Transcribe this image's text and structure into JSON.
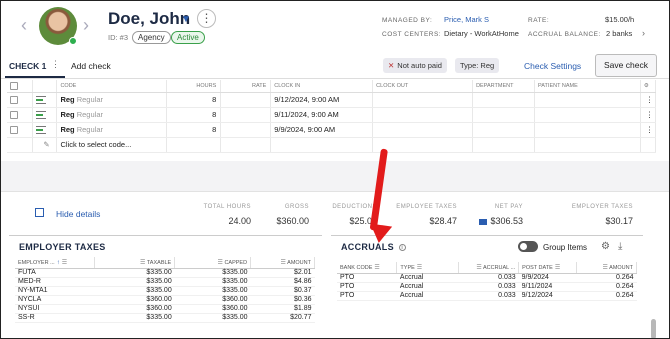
{
  "employee": {
    "name": "Doe, John",
    "id_label": "ID: #3",
    "badges": [
      "Agency",
      "Active"
    ]
  },
  "meta": {
    "managed_by_label": "MANAGED BY:",
    "managed_by_value": "Price, Mark S",
    "cost_centers_label": "COST CENTERS:",
    "cost_centers_value": "Dietary - WorkAtHome",
    "rate_label": "RATE:",
    "rate_value": "$15.00/h",
    "accrual_label": "ACCRUAL BALANCE:",
    "accrual_value": "2 banks"
  },
  "tabs": {
    "check1": "CHECK 1",
    "add_check": "Add check",
    "chip_not_auto_paid": "Not auto paid",
    "chip_type": "Type: Reg",
    "check_settings": "Check Settings",
    "save_check": "Save check"
  },
  "pay_table": {
    "columns": [
      "CODE",
      "HOURS",
      "RATE",
      "CLOCK IN",
      "CLOCK OUT",
      "DEPARTMENT",
      "PATIENT NAME"
    ],
    "rows": [
      {
        "code": "Reg",
        "type": "Regular",
        "hours": "8",
        "clock_in": "9/12/2024, 9:00 AM"
      },
      {
        "code": "Reg",
        "type": "Regular",
        "hours": "8",
        "clock_in": "9/11/2024, 9:00 AM"
      },
      {
        "code": "Reg",
        "type": "Regular",
        "hours": "8",
        "clock_in": "9/9/2024, 9:00 AM"
      }
    ],
    "new_row_placeholder": "Click to select code..."
  },
  "summary": {
    "hide_details": "Hide details",
    "items": [
      {
        "label": "TOTAL HOURS",
        "value": "24.00"
      },
      {
        "label": "GROSS",
        "value": "$360.00"
      },
      {
        "label": "DEDUCTIONS",
        "value": "$25.00"
      },
      {
        "label": "EMPLOYEE TAXES",
        "value": "$28.47"
      },
      {
        "label": "NET PAY",
        "value": "$306.53"
      },
      {
        "label": "EMPLOYER TAXES",
        "value": "$30.17"
      }
    ]
  },
  "employer_taxes": {
    "title": "EMPLOYER TAXES",
    "columns": [
      "EMPLOYER ...",
      "TAXABLE",
      "CAPPED",
      "AMOUNT"
    ],
    "rows": [
      {
        "name": "FUTA",
        "taxable": "$335.00",
        "capped": "$335.00",
        "amount": "$2.01"
      },
      {
        "name": "MED-R",
        "taxable": "$335.00",
        "capped": "$335.00",
        "amount": "$4.86"
      },
      {
        "name": "NY-MTA1",
        "taxable": "$335.00",
        "capped": "$335.00",
        "amount": "$0.37"
      },
      {
        "name": "NYCLA",
        "taxable": "$360.00",
        "capped": "$360.00",
        "amount": "$0.36"
      },
      {
        "name": "NYSUI",
        "taxable": "$360.00",
        "capped": "$360.00",
        "amount": "$1.89"
      },
      {
        "name": "SS-R",
        "taxable": "$335.00",
        "capped": "$335.00",
        "amount": "$20.77"
      }
    ]
  },
  "accruals": {
    "title": "ACCRUALS",
    "group_items": "Group Items",
    "columns": [
      "BANK CODE",
      "TYPE",
      "ACCRUAL ...",
      "POST DATE",
      "AMOUNT"
    ],
    "rows": [
      {
        "bank": "PTO",
        "type": "Accrual",
        "accrual": "0.033",
        "post_date": "9/9/2024",
        "amount": "0.264"
      },
      {
        "bank": "PTO",
        "type": "Accrual",
        "accrual": "0.033",
        "post_date": "9/11/2024",
        "amount": "0.264"
      },
      {
        "bank": "PTO",
        "type": "Accrual",
        "accrual": "0.033",
        "post_date": "9/12/2024",
        "amount": "0.264"
      }
    ]
  },
  "colors": {
    "accent": "#2a5db0",
    "annotation_arrow": "#e21b1b",
    "active_badge": "#2d8a3b"
  }
}
